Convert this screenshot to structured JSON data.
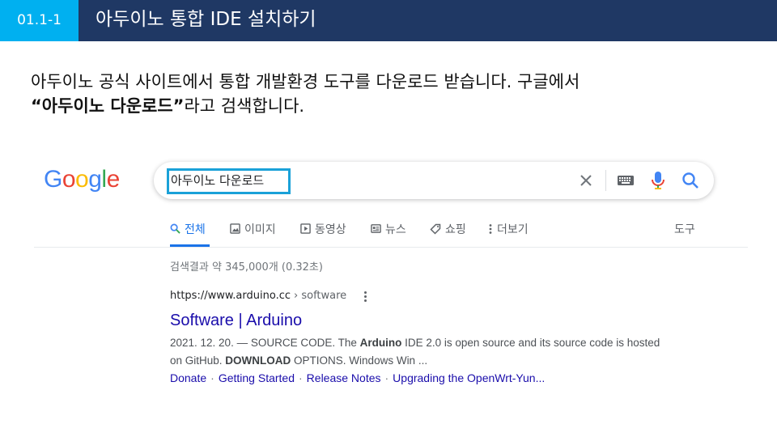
{
  "slide": {
    "number": "01.1-1",
    "title": "아두이노 통합 IDE 설치하기",
    "intro_line1": "아두이노 공식 사이트에서 통합 개발환경 도구를 다운로드 받습니다. 구글에서",
    "intro_quote": "“아두이노 다운로드”",
    "intro_tail": "라고 검색합니다."
  },
  "google": {
    "logo": [
      "G",
      "o",
      "o",
      "g",
      "l",
      "e"
    ],
    "logo_colors": [
      "#4285f4",
      "#ea4335",
      "#fbbc05",
      "#4285f4",
      "#34a853",
      "#ea4335"
    ],
    "search_query": "아두이노 다운로드",
    "tabs": [
      {
        "label": "전체",
        "icon": "search-icon",
        "active": true
      },
      {
        "label": "이미지",
        "icon": "image-icon"
      },
      {
        "label": "동영상",
        "icon": "video-icon"
      },
      {
        "label": "뉴스",
        "icon": "news-icon"
      },
      {
        "label": "쇼핑",
        "icon": "tag-icon"
      },
      {
        "label": "더보기",
        "icon": "more-vert-icon"
      },
      {
        "label": "도구"
      }
    ],
    "result_stats": "검색결과 약 345,000개 (0.32초)",
    "result": {
      "site": "https://www.arduino.cc",
      "path": "› software",
      "title": "Software | Arduino",
      "snippet_date": "2021. 12. 20. — SOURCE CODE. The ",
      "snippet_b1": "Arduino",
      "snippet_mid": " IDE 2.0 is open source and its source code is hosted on GitHub. ",
      "snippet_b2": "DOWNLOAD",
      "snippet_end": " OPTIONS. Windows Win ...",
      "sitelinks": [
        "Donate",
        "Getting Started",
        "Release Notes",
        "Upgrading the OpenWrt-Yun..."
      ]
    },
    "colors": {
      "link": "#1a0dab",
      "accent": "#1a73e8",
      "highlight": "#1aa1d8"
    }
  }
}
